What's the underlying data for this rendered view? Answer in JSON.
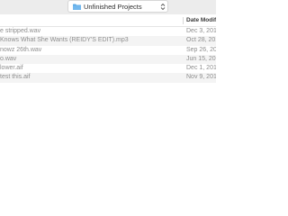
{
  "location": {
    "folder_name": "Unfinished Projects"
  },
  "columns": {
    "date": "Date Modif"
  },
  "files": [
    {
      "name": "e stripped.wav",
      "date": "Dec 3, 201"
    },
    {
      "name": "Knows What She Wants (REIDY'S EDIT).mp3",
      "date": "Oct 28, 201"
    },
    {
      "name": "nowz 26th.wav",
      "date": "Sep 26, 201"
    },
    {
      "name": "o.wav",
      "date": "Jun 15, 201"
    },
    {
      "name": "lower.aif",
      "date": "Dec 1, 201"
    },
    {
      "name": "test this.aif",
      "date": "Nov 9, 201"
    }
  ],
  "icons": {
    "folder": "folder-icon",
    "popup": "updown-chevron-icon"
  },
  "colors": {
    "folder_icon": "#5aa9e6",
    "toolbar_bg": "#ececec",
    "row_alt": "#f4f4f4",
    "row_text": "#8e8e8e"
  }
}
